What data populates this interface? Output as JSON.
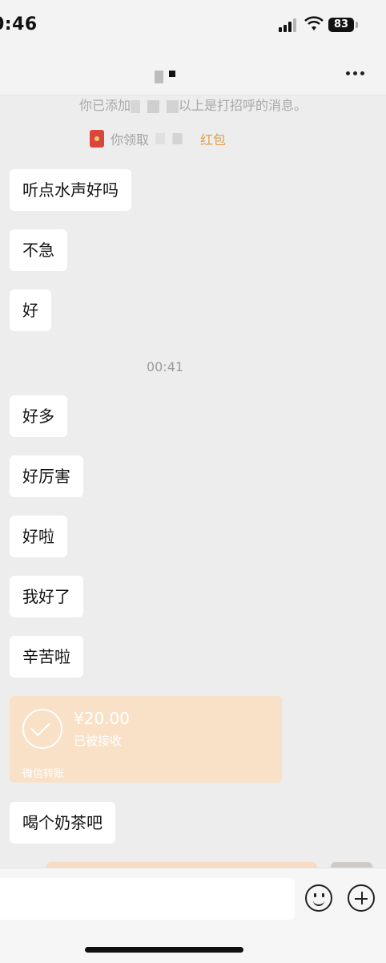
{
  "status_bar": {
    "time": "0:46",
    "battery": "83"
  },
  "system": {
    "added_prefix": "你已添加",
    "added_suffix": "以上是打招呼的消息。",
    "redpacket_prefix": "你领取",
    "redpacket_suffix": "红包"
  },
  "messages": [
    {
      "text": "听点水声好吗"
    },
    {
      "text": "不急"
    },
    {
      "text": "好"
    },
    {
      "text": "好多"
    },
    {
      "text": "好厉害"
    },
    {
      "text": "好啦"
    },
    {
      "text": "我好了"
    },
    {
      "text": "辛苦啦"
    },
    {
      "text": "喝个奶茶吧"
    }
  ],
  "time_divider": "00:41",
  "transfer": {
    "amount": "¥20.00",
    "status": "已被接收",
    "footer": "微信转账"
  },
  "icons": {
    "more": "more-icon",
    "emoji": "emoji-icon",
    "plus": "plus-icon",
    "redpacket": "red-packet-icon"
  }
}
